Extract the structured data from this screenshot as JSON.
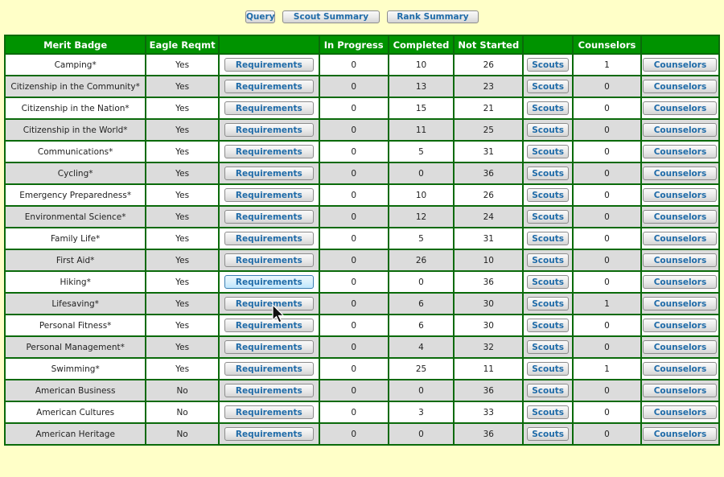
{
  "toolbar": {
    "query_label": "Query",
    "scout_summary_label": "Scout Summary",
    "rank_summary_label": "Rank Summary"
  },
  "table": {
    "headers": {
      "merit_badge": "Merit Badge",
      "eagle_reqmt": "Eagle Reqmt",
      "requirements": "",
      "in_progress": "In Progress",
      "completed": "Completed",
      "not_started": "Not Started",
      "scouts": "",
      "counselors": "Counselors",
      "counselors_btn": ""
    },
    "button_labels": {
      "requirements": "Requirements",
      "scouts": "Scouts",
      "counselors": "Counselors"
    },
    "rows": [
      {
        "badge": "Camping*",
        "eagle": "Yes",
        "in_progress": "0",
        "completed": "10",
        "not_started": "26",
        "counselors": "1"
      },
      {
        "badge": "Citizenship in the Community*",
        "eagle": "Yes",
        "in_progress": "0",
        "completed": "13",
        "not_started": "23",
        "counselors": "0"
      },
      {
        "badge": "Citizenship in the Nation*",
        "eagle": "Yes",
        "in_progress": "0",
        "completed": "15",
        "not_started": "21",
        "counselors": "0"
      },
      {
        "badge": "Citizenship in the World*",
        "eagle": "Yes",
        "in_progress": "0",
        "completed": "11",
        "not_started": "25",
        "counselors": "0"
      },
      {
        "badge": "Communications*",
        "eagle": "Yes",
        "in_progress": "0",
        "completed": "5",
        "not_started": "31",
        "counselors": "0"
      },
      {
        "badge": "Cycling*",
        "eagle": "Yes",
        "in_progress": "0",
        "completed": "0",
        "not_started": "36",
        "counselors": "0"
      },
      {
        "badge": "Emergency Preparedness*",
        "eagle": "Yes",
        "in_progress": "0",
        "completed": "10",
        "not_started": "26",
        "counselors": "0"
      },
      {
        "badge": "Environmental Science*",
        "eagle": "Yes",
        "in_progress": "0",
        "completed": "12",
        "not_started": "24",
        "counselors": "0"
      },
      {
        "badge": "Family Life*",
        "eagle": "Yes",
        "in_progress": "0",
        "completed": "5",
        "not_started": "31",
        "counselors": "0"
      },
      {
        "badge": "First Aid*",
        "eagle": "Yes",
        "in_progress": "0",
        "completed": "26",
        "not_started": "10",
        "counselors": "0"
      },
      {
        "badge": "Hiking*",
        "eagle": "Yes",
        "in_progress": "0",
        "completed": "0",
        "not_started": "36",
        "counselors": "0",
        "hover": true
      },
      {
        "badge": "Lifesaving*",
        "eagle": "Yes",
        "in_progress": "0",
        "completed": "6",
        "not_started": "30",
        "counselors": "1"
      },
      {
        "badge": "Personal Fitness*",
        "eagle": "Yes",
        "in_progress": "0",
        "completed": "6",
        "not_started": "30",
        "counselors": "0"
      },
      {
        "badge": "Personal Management*",
        "eagle": "Yes",
        "in_progress": "0",
        "completed": "4",
        "not_started": "32",
        "counselors": "0"
      },
      {
        "badge": "Swimming*",
        "eagle": "Yes",
        "in_progress": "0",
        "completed": "25",
        "not_started": "11",
        "counselors": "1"
      },
      {
        "badge": "American Business",
        "eagle": "No",
        "in_progress": "0",
        "completed": "0",
        "not_started": "36",
        "counselors": "0"
      },
      {
        "badge": "American Cultures",
        "eagle": "No",
        "in_progress": "0",
        "completed": "3",
        "not_started": "33",
        "counselors": "0"
      },
      {
        "badge": "American Heritage",
        "eagle": "No",
        "in_progress": "0",
        "completed": "0",
        "not_started": "36",
        "counselors": "0"
      }
    ]
  },
  "colors": {
    "page_background": "#ffffc8",
    "header_green": "#009300",
    "grid_border": "#0a6a0a",
    "button_text": "#1f6ba8",
    "row_alt": "#dcdcdc"
  }
}
